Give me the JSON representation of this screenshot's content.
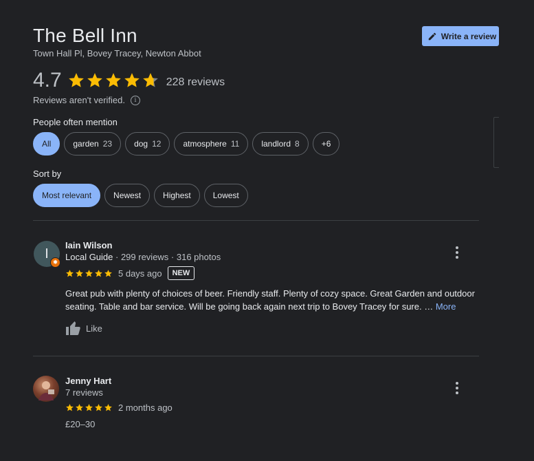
{
  "place": {
    "name": "The Bell Inn",
    "address": "Town Hall Pl, Bovey Tracey, Newton Abbot",
    "rating": "4.7",
    "rating_value": 4.7,
    "reviews_count": "228 reviews",
    "verified_note": "Reviews aren't verified.",
    "info_icon": "i"
  },
  "write_review": {
    "label": "Write a review",
    "icon": "pencil-icon"
  },
  "mentions": {
    "label": "People often mention",
    "chips": [
      {
        "label": "All",
        "count": "",
        "active": true
      },
      {
        "label": "garden",
        "count": "23",
        "active": false
      },
      {
        "label": "dog",
        "count": "12",
        "active": false
      },
      {
        "label": "atmosphere",
        "count": "11",
        "active": false
      },
      {
        "label": "landlord",
        "count": "8",
        "active": false
      },
      {
        "label": "+6",
        "count": "",
        "active": false
      }
    ]
  },
  "sort": {
    "label": "Sort by",
    "options": [
      {
        "label": "Most relevant",
        "active": true
      },
      {
        "label": "Newest",
        "active": false
      },
      {
        "label": "Highest",
        "active": false
      },
      {
        "label": "Lowest",
        "active": false
      }
    ]
  },
  "reviews": [
    {
      "initial": "I",
      "name": "Iain Wilson",
      "local_guide": "Local Guide",
      "stats": " · 299 reviews · 316 photos",
      "stars": 5,
      "date": "5 days ago",
      "new_badge": "NEW",
      "text": "Great pub with plenty of choices of beer. Friendly staff. Plenty of cozy space. Great Garden and outdoor seating. Table and bar service. Will be going back again next trip to Bovey Tracey for sure. …",
      "more": "More",
      "like": "Like"
    },
    {
      "initial": "",
      "name": "Jenny Hart",
      "stats": "7 reviews",
      "stars": 5,
      "date": "2 months ago",
      "price": "£20–30"
    }
  ],
  "colors": {
    "background": "#202124",
    "accent": "#8ab4f8",
    "star": "#fbbc04",
    "guide_badge": "#e8710a"
  }
}
